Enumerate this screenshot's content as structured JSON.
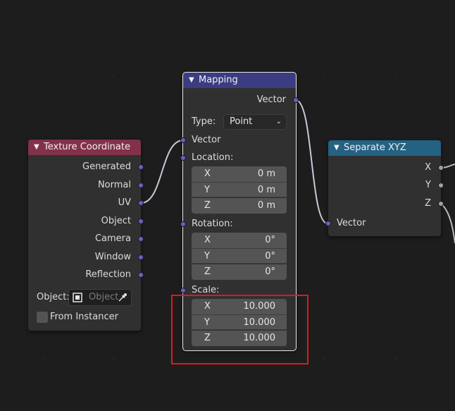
{
  "colors": {
    "background": "#1d1d1d",
    "node_body": "#303030",
    "texture_coordinate_header": "#83314a",
    "mapping_header": "#3c3c83",
    "separate_xyz_header": "#246283",
    "vector_socket": "#6363c7",
    "float_socket": "#a1a1a1",
    "highlight": "#e01818"
  },
  "texture_coordinate": {
    "title": "Texture Coordinate",
    "outputs": [
      "Generated",
      "Normal",
      "UV",
      "Object",
      "Camera",
      "Window",
      "Reflection"
    ],
    "object_label": "Object:",
    "object_placeholder": "Object",
    "from_instancer_label": "From Instancer"
  },
  "mapping": {
    "title": "Mapping",
    "output_label": "Vector",
    "type_label": "Type:",
    "type_value": "Point",
    "vector_input_label": "Vector",
    "location_label": "Location:",
    "location": [
      {
        "axis": "X",
        "value": "0 m"
      },
      {
        "axis": "Y",
        "value": "0 m"
      },
      {
        "axis": "Z",
        "value": "0 m"
      }
    ],
    "rotation_label": "Rotation:",
    "rotation": [
      {
        "axis": "X",
        "value": "0°"
      },
      {
        "axis": "Y",
        "value": "0°"
      },
      {
        "axis": "Z",
        "value": "0°"
      }
    ],
    "scale_label": "Scale:",
    "scale": [
      {
        "axis": "X",
        "value": "10.000"
      },
      {
        "axis": "Y",
        "value": "10.000"
      },
      {
        "axis": "Z",
        "value": "10.000"
      }
    ]
  },
  "separate_xyz": {
    "title": "Separate XYZ",
    "outputs": [
      "X",
      "Y",
      "Z"
    ],
    "input_label": "Vector"
  },
  "icons": [
    "chevron-down-icon",
    "object-cube-icon",
    "eyedropper-icon",
    "dropdown-arrow-icon"
  ]
}
